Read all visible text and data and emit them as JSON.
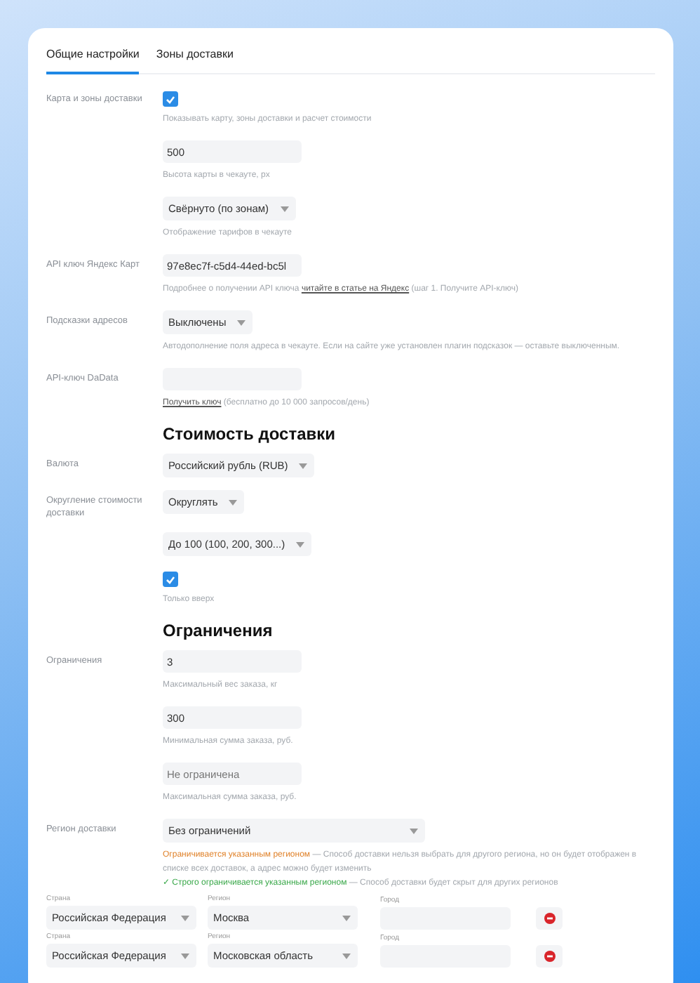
{
  "tabs": [
    {
      "label": "Общие настройки",
      "selected": true
    },
    {
      "label": "Зоны доставки",
      "selected": false
    }
  ],
  "rows": [
    {
      "kind": "checkbox",
      "label": "Карта и зоны доставки",
      "checked": true,
      "hint": "Показывать карту, зоны доставки и расчет стоимости"
    },
    {
      "kind": "input",
      "value": "500",
      "hint": "Высота карты в чекауте, px"
    },
    {
      "kind": "select",
      "value": "Свёрнуто (по зонам)",
      "hint": "Отображение тарифов в чекауте"
    },
    {
      "kind": "input",
      "label": "API ключ Яндекс Карт",
      "value": "97e8ec7f-c5d4-44ed-bc5l",
      "hint": "Подробнее о получении API ключа",
      "link": "читайте в статье на Яндекс",
      "hint_after": "(шаг 1. Получите API-ключ)"
    },
    {
      "kind": "select",
      "label": "Подсказки адресов",
      "value": "Выключены",
      "hint": "Автодополнение поля адреса в чекауте. Если на сайте уже установлен плагин подсказок — оставьте выключенным."
    },
    {
      "kind": "input",
      "label": "API-ключ DaData",
      "link": "Получить ключ",
      "hint_after": "(бесплатно до 10 000 запросов/день)"
    },
    {
      "kind": "heading",
      "text": "Стоимость доставки"
    },
    {
      "kind": "select",
      "label": "Валюта",
      "value": "Российский рубль (RUB)"
    },
    {
      "kind": "select",
      "label": "Округление стоимости доставки",
      "value": "Округлять"
    },
    {
      "kind": "select",
      "value": "До 100 (100, 200, 300...)"
    },
    {
      "kind": "checkbox",
      "checked": true,
      "hint": "Только вверх"
    },
    {
      "kind": "heading",
      "text": "Ограничения"
    },
    {
      "kind": "input",
      "label": "Ограничения",
      "value": "3",
      "hint": "Максимальный вес заказа, кг"
    },
    {
      "kind": "input",
      "value": "300",
      "hint": "Минимальная сумма заказа, руб."
    },
    {
      "kind": "input",
      "placeholder": "Не ограничена",
      "hint": "Максимальная сумма заказа, руб."
    }
  ],
  "region": {
    "label": "Регион доставки",
    "value": "Без ограничений",
    "notes": [
      {
        "title": "Ограничивается указанным регионом",
        "text": "— Способ доставки нельзя выбрать для другого региона, но он будет отображен в списке всех доставок, а адрес можно будет изменить",
        "color": "#e0822a"
      },
      {
        "title": "✓ Строго ограничивается указанным регионом",
        "text": "— Способ доставки будет скрыт для других регионов",
        "color": "#3aa84a"
      }
    ],
    "entries": [
      {
        "country_label": "Страна",
        "country": "Российская Федерация",
        "region_label": "Регион",
        "region": "Москва",
        "city_label": "Город"
      },
      {
        "country_label": "Страна",
        "country": "Российская Федерация",
        "region_label": "Регион",
        "region": "Московская область",
        "city_label": "Город"
      }
    ]
  }
}
